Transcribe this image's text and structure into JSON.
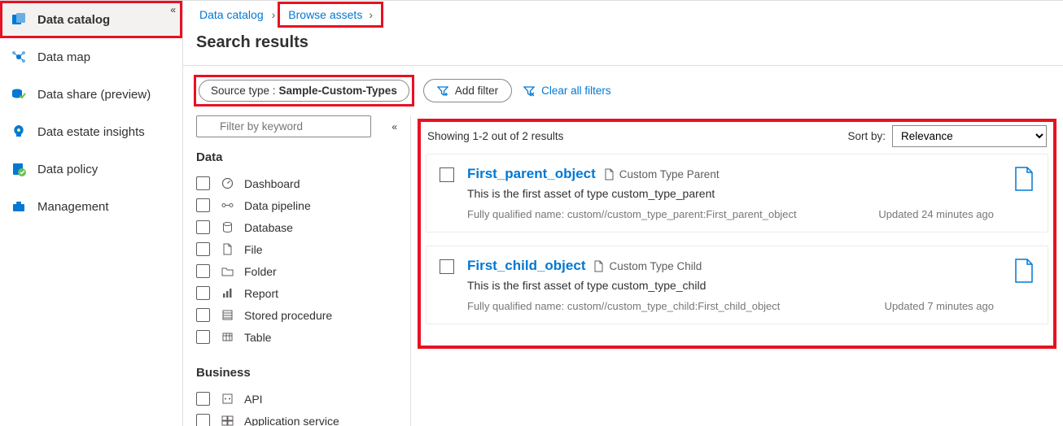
{
  "nav": {
    "items": [
      {
        "label": "Data catalog"
      },
      {
        "label": "Data map"
      },
      {
        "label": "Data share (preview)"
      },
      {
        "label": "Data estate insights"
      },
      {
        "label": "Data policy"
      },
      {
        "label": "Management"
      }
    ]
  },
  "breadcrumb": {
    "root": "Data catalog",
    "leaf": "Browse assets"
  },
  "page_title": "Search results",
  "filters_row": {
    "chip_prefix": "Source type : ",
    "chip_value": "Sample-Custom-Types",
    "add_filter": "Add filter",
    "clear_all": "Clear all filters"
  },
  "filter_sidebar": {
    "placeholder": "Filter by keyword",
    "sections": [
      {
        "heading": "Data",
        "items": [
          "Dashboard",
          "Data pipeline",
          "Database",
          "File",
          "Folder",
          "Report",
          "Stored procedure",
          "Table"
        ]
      },
      {
        "heading": "Business",
        "items": [
          "API",
          "Application service"
        ]
      }
    ]
  },
  "results": {
    "count_text": "Showing 1-2 out of 2 results",
    "sort_label": "Sort by:",
    "sort_value": "Relevance",
    "cards": [
      {
        "title": "First_parent_object",
        "type_label": "Custom Type Parent",
        "desc": "This is the first asset of type custom_type_parent",
        "fqn": "Fully qualified name: custom//custom_type_parent:First_parent_object",
        "updated": "Updated 24 minutes ago"
      },
      {
        "title": "First_child_object",
        "type_label": "Custom Type Child",
        "desc": "This is the first asset of type custom_type_child",
        "fqn": "Fully qualified name: custom//custom_type_child:First_child_object",
        "updated": "Updated 7 minutes ago"
      }
    ]
  }
}
